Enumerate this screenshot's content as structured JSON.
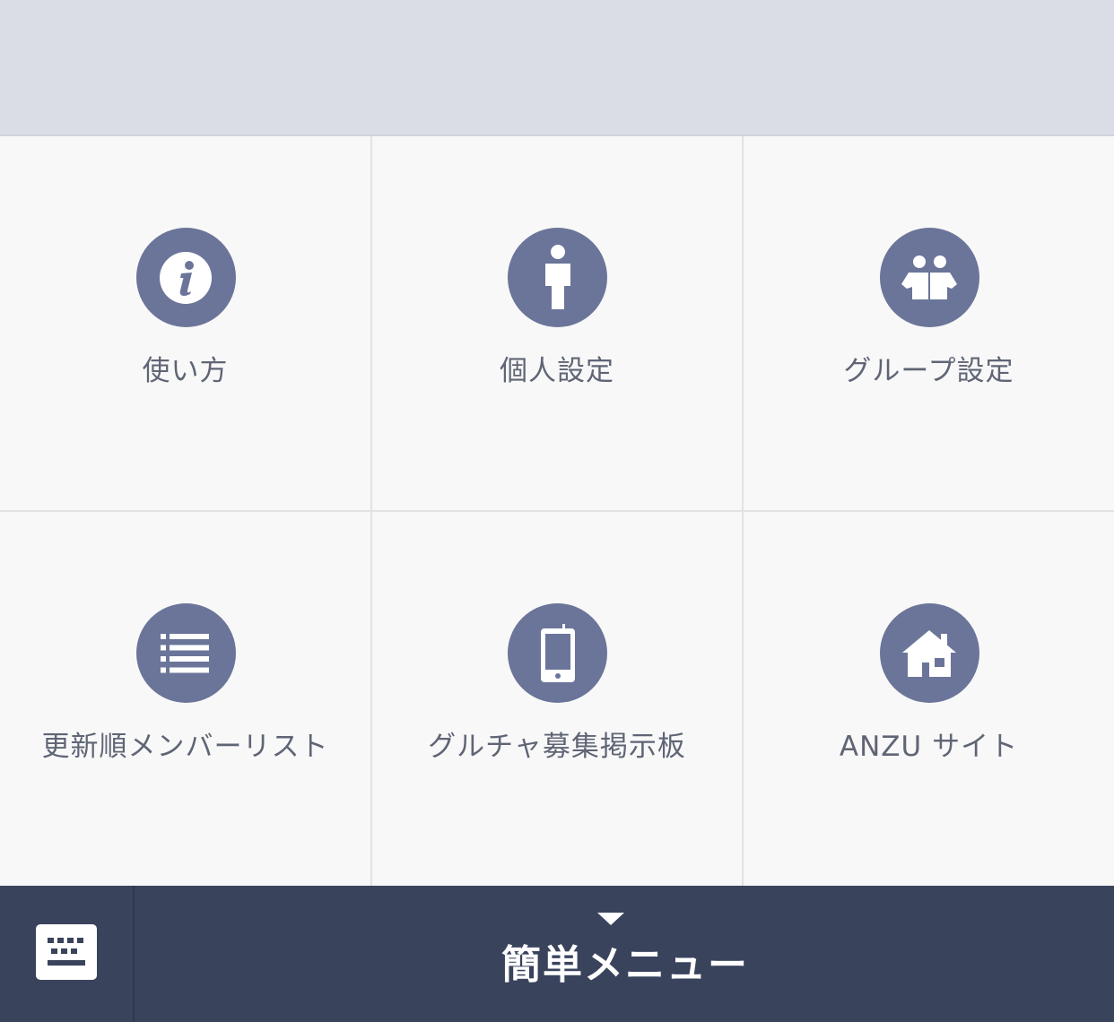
{
  "menu": {
    "items": [
      {
        "label": "使い方",
        "icon": "info-icon"
      },
      {
        "label": "個人設定",
        "icon": "person-icon"
      },
      {
        "label": "グループ設定",
        "icon": "group-icon"
      },
      {
        "label": "更新順メンバーリスト",
        "icon": "list-icon"
      },
      {
        "label": "グルチャ募集掲示板",
        "icon": "smartphone-icon"
      },
      {
        "label": "ANZU サイト",
        "icon": "home-icon"
      }
    ]
  },
  "bottom_bar": {
    "keyboard_icon": "keyboard-icon",
    "toggle_icon": "triangle-down-icon",
    "title": "簡単メニュー"
  },
  "colors": {
    "top_area": "#dadde6",
    "grid_background": "#f8f8f8",
    "icon_circle": "#6b7599",
    "label_text": "#5f6575",
    "bottom_bar": "#39435c"
  }
}
